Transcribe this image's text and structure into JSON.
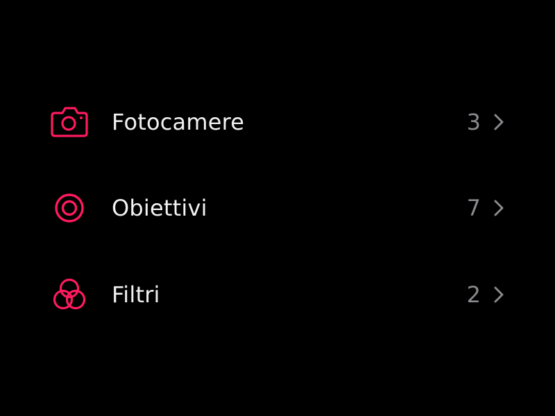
{
  "theme": {
    "background": "#000000",
    "accent": "#ff1a5e",
    "label_color": "#f2f2f2",
    "count_color": "#8a8a8e",
    "chevron_color": "#8a8a8e"
  },
  "categories": [
    {
      "label": "Fotocamere",
      "count": "3",
      "icon": "camera-icon"
    },
    {
      "label": "Obiettivi",
      "count": "7",
      "icon": "lens-icon"
    },
    {
      "label": "Filtri",
      "count": "2",
      "icon": "filters-icon"
    }
  ]
}
